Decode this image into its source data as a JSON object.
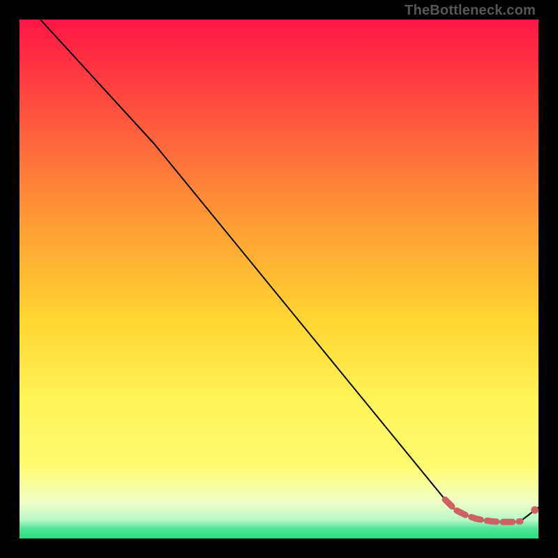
{
  "watermark": "TheBottleneck.com",
  "colors": {
    "top": "#ff1646",
    "mid_upper": "#ff7f3a",
    "mid": "#ffd632",
    "mid_lower": "#fffb70",
    "pale": "#f0ffc8",
    "green": "#25e07d",
    "line": "#000000",
    "series_stroke": "#cd6264",
    "series_fill": "#cd6264",
    "background": "#000000"
  },
  "chart_data": {
    "type": "line",
    "title": "",
    "xlabel": "",
    "ylabel": "",
    "xlim": [
      0,
      100
    ],
    "ylim": [
      0,
      100
    ],
    "series": [
      {
        "name": "main-curve",
        "x": [
          4,
          26,
          82,
          84,
          86,
          88,
          89.5,
          91,
          92.5,
          94,
          95.5,
          96.5,
          100
        ],
        "y": [
          100,
          76,
          7.5,
          5.5,
          4.5,
          3.8,
          3.5,
          3.3,
          3.2,
          3.2,
          3.2,
          3.3,
          6
        ],
        "style": "solid-thin-black"
      },
      {
        "name": "highlight-segment",
        "x": [
          82,
          84,
          86,
          88,
          89.5,
          91,
          92.5,
          94,
          95.5,
          96.5
        ],
        "y": [
          7.5,
          5.5,
          4.5,
          3.8,
          3.5,
          3.3,
          3.2,
          3.2,
          3.2,
          3.3
        ],
        "style": "thick-dashed-rose"
      },
      {
        "name": "end-dot",
        "x": [
          99.3
        ],
        "y": [
          5.5
        ],
        "style": "dot-rose"
      }
    ]
  }
}
